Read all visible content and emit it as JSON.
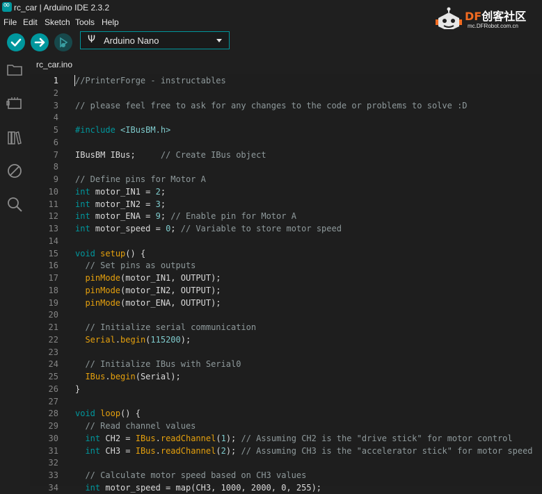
{
  "window": {
    "title": "rc_car | Arduino IDE 2.3.2"
  },
  "menu": [
    "File",
    "Edit",
    "Sketch",
    "Tools",
    "Help"
  ],
  "toolbar": {
    "verify_icon": "checkmark-icon",
    "upload_icon": "arrow-right-icon",
    "debug_icon": "debug-icon",
    "board": "Arduino Nano"
  },
  "watermark": {
    "brand": "DF",
    "brand_cn": "创客社区",
    "url": "mc.DFRobot.com.cn"
  },
  "sidebar": [
    "folder-icon",
    "board-icon",
    "library-icon",
    "debug-disabled-icon",
    "search-icon"
  ],
  "tabs": [
    {
      "label": "rc_car.ino"
    }
  ],
  "editor": {
    "active_line": 1,
    "lines": [
      [
        [
          "c",
          "//PrinterForge - instructables"
        ]
      ],
      [],
      [
        [
          "c",
          "// please feel free to ask for any changes to the code or problems to solve :D"
        ]
      ],
      [],
      [
        [
          "k",
          "#include"
        ],
        [
          "t",
          " "
        ],
        [
          "s",
          "<IBusBM.h>"
        ]
      ],
      [],
      [
        [
          "t",
          "IBusBM IBus;     "
        ],
        [
          "c",
          "// Create IBus object"
        ]
      ],
      [],
      [
        [
          "c",
          "// Define pins for Motor A"
        ]
      ],
      [
        [
          "k",
          "int"
        ],
        [
          "t",
          " motor_IN1 = "
        ],
        [
          "n",
          "2"
        ],
        [
          "t",
          ";"
        ]
      ],
      [
        [
          "k",
          "int"
        ],
        [
          "t",
          " motor_IN2 = "
        ],
        [
          "n",
          "3"
        ],
        [
          "t",
          ";"
        ]
      ],
      [
        [
          "k",
          "int"
        ],
        [
          "t",
          " motor_ENA = "
        ],
        [
          "n",
          "9"
        ],
        [
          "t",
          "; "
        ],
        [
          "c",
          "// Enable pin for Motor A"
        ]
      ],
      [
        [
          "k",
          "int"
        ],
        [
          "t",
          " motor_speed = "
        ],
        [
          "n",
          "0"
        ],
        [
          "t",
          "; "
        ],
        [
          "c",
          "// Variable to store motor speed"
        ]
      ],
      [],
      [
        [
          "k",
          "void"
        ],
        [
          "t",
          " "
        ],
        [
          "f",
          "setup"
        ],
        [
          "t",
          "() {"
        ]
      ],
      [
        [
          "t",
          "  "
        ],
        [
          "c",
          "// Set pins as outputs"
        ]
      ],
      [
        [
          "t",
          "  "
        ],
        [
          "f",
          "pinMode"
        ],
        [
          "t",
          "(motor_IN1, OUTPUT);"
        ]
      ],
      [
        [
          "t",
          "  "
        ],
        [
          "f",
          "pinMode"
        ],
        [
          "t",
          "(motor_IN2, OUTPUT);"
        ]
      ],
      [
        [
          "t",
          "  "
        ],
        [
          "f",
          "pinMode"
        ],
        [
          "t",
          "(motor_ENA, OUTPUT);"
        ]
      ],
      [],
      [
        [
          "t",
          "  "
        ],
        [
          "c",
          "// Initialize serial communication"
        ]
      ],
      [
        [
          "t",
          "  "
        ],
        [
          "f",
          "Serial"
        ],
        [
          "t",
          "."
        ],
        [
          "f",
          "begin"
        ],
        [
          "t",
          "("
        ],
        [
          "n",
          "115200"
        ],
        [
          "t",
          ");"
        ]
      ],
      [],
      [
        [
          "t",
          "  "
        ],
        [
          "c",
          "// Initialize IBus with Serial0"
        ]
      ],
      [
        [
          "t",
          "  "
        ],
        [
          "f",
          "IBus"
        ],
        [
          "t",
          "."
        ],
        [
          "f",
          "begin"
        ],
        [
          "t",
          "(Serial);"
        ]
      ],
      [
        [
          "t",
          "}"
        ]
      ],
      [],
      [
        [
          "k",
          "void"
        ],
        [
          "t",
          " "
        ],
        [
          "f",
          "loop"
        ],
        [
          "t",
          "() {"
        ]
      ],
      [
        [
          "t",
          "  "
        ],
        [
          "c",
          "// Read channel values"
        ]
      ],
      [
        [
          "t",
          "  "
        ],
        [
          "k",
          "int"
        ],
        [
          "t",
          " CH2 = "
        ],
        [
          "f",
          "IBus"
        ],
        [
          "t",
          "."
        ],
        [
          "f",
          "readChannel"
        ],
        [
          "t",
          "("
        ],
        [
          "n",
          "1"
        ],
        [
          "t",
          "); "
        ],
        [
          "c",
          "// Assuming CH2 is the \"drive stick\" for motor control"
        ]
      ],
      [
        [
          "t",
          "  "
        ],
        [
          "k",
          "int"
        ],
        [
          "t",
          " CH3 = "
        ],
        [
          "f",
          "IBus"
        ],
        [
          "t",
          "."
        ],
        [
          "f",
          "readChannel"
        ],
        [
          "t",
          "("
        ],
        [
          "n",
          "2"
        ],
        [
          "t",
          "); "
        ],
        [
          "c",
          "// Assuming CH3 is the \"accelerator stick\" for motor speed"
        ]
      ],
      [],
      [
        [
          "t",
          "  "
        ],
        [
          "c",
          "// Calculate motor speed based on CH3 values"
        ]
      ],
      [
        [
          "t",
          "  "
        ],
        [
          "k",
          "int"
        ],
        [
          "t",
          " motor_speed = map(CH3, 1000, 2000, 0, 255);"
        ]
      ]
    ]
  }
}
